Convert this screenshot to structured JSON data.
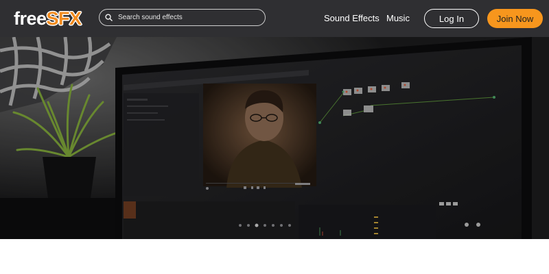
{
  "brand": {
    "logo_free": "free",
    "logo_sfx": "SFX",
    "accent_color": "#f7961d"
  },
  "header": {
    "search": {
      "placeholder": "Search sound effects",
      "icon": "search-icon"
    },
    "nav": {
      "sound_effects": "Sound Effects",
      "music": "Music"
    },
    "login_label": "Log In",
    "join_label": "Join Now"
  },
  "hero": {
    "image_subject": "Video editing software on monitor with plant"
  }
}
